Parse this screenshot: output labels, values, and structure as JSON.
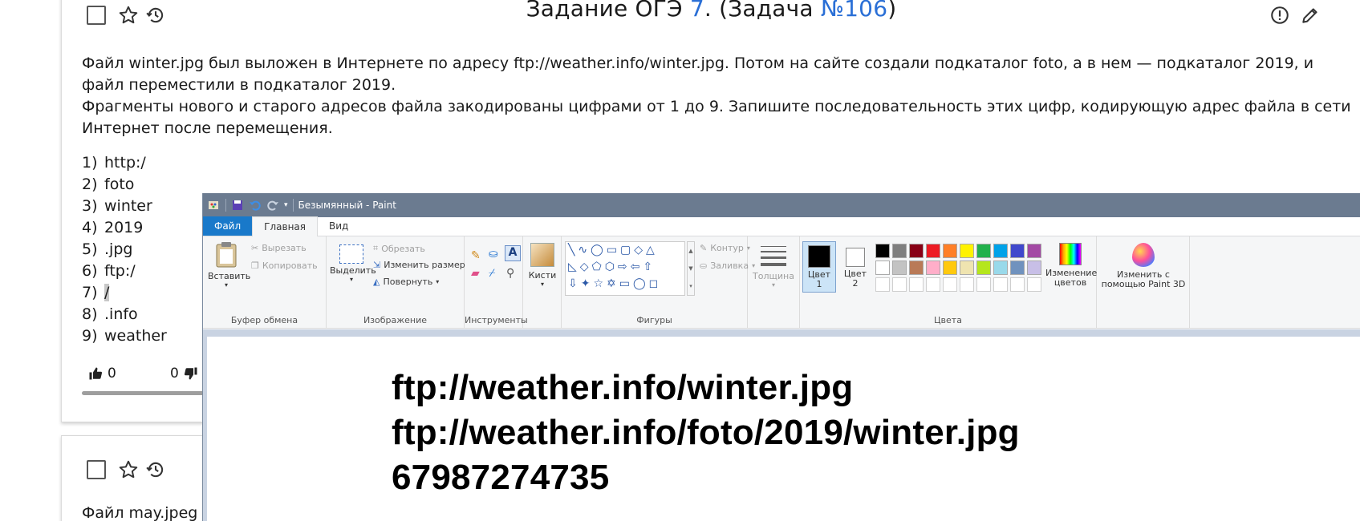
{
  "card1": {
    "title_prefix": "Задание ОГЭ ",
    "title_num": "7",
    "title_mid": ". (Задача ",
    "title_link": "№106",
    "title_end": ")",
    "text1": "Файл winter.jpg был выложен в Интернете по адресу ftp://weather.info/winter.jpg. Потом на сайте создали подкаталог foto, а в нем  — подкаталог 2019, и файл переместили в подкаталог 2019.",
    "text2": "Фрагменты нового и старого адресов файла закодированы цифрами от 1 до 9. Запишите последовательность этих цифр, кодирующую адрес файла в сети Интернет после перемещения.",
    "options": [
      {
        "num": "1)",
        "text": "http:/"
      },
      {
        "num": "2)",
        "text": "foto"
      },
      {
        "num": "3)",
        "text": "winter"
      },
      {
        "num": "4)",
        "text": "2019"
      },
      {
        "num": "5)",
        "text": ".jpg"
      },
      {
        "num": "6)",
        "text": "ftp:/"
      },
      {
        "num": "7)",
        "text": "/"
      },
      {
        "num": "8)",
        "text": ".info"
      },
      {
        "num": "9)",
        "text": "weather"
      }
    ],
    "likes": "0",
    "dislikes": "0"
  },
  "card2": {
    "text": "Файл may.jpeg "
  },
  "paint": {
    "title": "Безымянный - Paint",
    "tabs": [
      "Файл",
      "Главная",
      "Вид"
    ],
    "clipboard": {
      "paste": "Вставить",
      "cut": "Вырезать",
      "copy": "Копировать",
      "label": "Буфер обмена"
    },
    "image": {
      "select": "Выделить",
      "crop": "Обрезать",
      "resize": "Изменить размер",
      "rotate": "Повернуть",
      "label": "Изображение"
    },
    "tools": {
      "label": "Инструменты"
    },
    "brushes": "Кисти",
    "shapes": {
      "label": "Фигуры",
      "outline": "Контур",
      "fill": "Заливка"
    },
    "size": "Толщина",
    "color1": "Цвет 1",
    "color2": "Цвет 2",
    "colors_label": "Цвета",
    "edit_colors": "Изменение цветов",
    "paint3d": "Изменить с помощью Paint 3D",
    "palette_row1": [
      "#000000",
      "#7f7f7f",
      "#880015",
      "#ed1c24",
      "#ff7f27",
      "#fff200",
      "#22b14c",
      "#00a2e8",
      "#3f48cc",
      "#a349a4"
    ],
    "palette_row2": [
      "#ffffff",
      "#c3c3c3",
      "#b97a57",
      "#ffaec9",
      "#ffc90e",
      "#efe4b0",
      "#b5e61d",
      "#99d9ea",
      "#7092be",
      "#c8bfe7"
    ],
    "canvas_lines": [
      "ftp://weather.info/winter.jpg",
      "ftp://weather.info/foto/2019/winter.jpg",
      "67987274735"
    ]
  }
}
